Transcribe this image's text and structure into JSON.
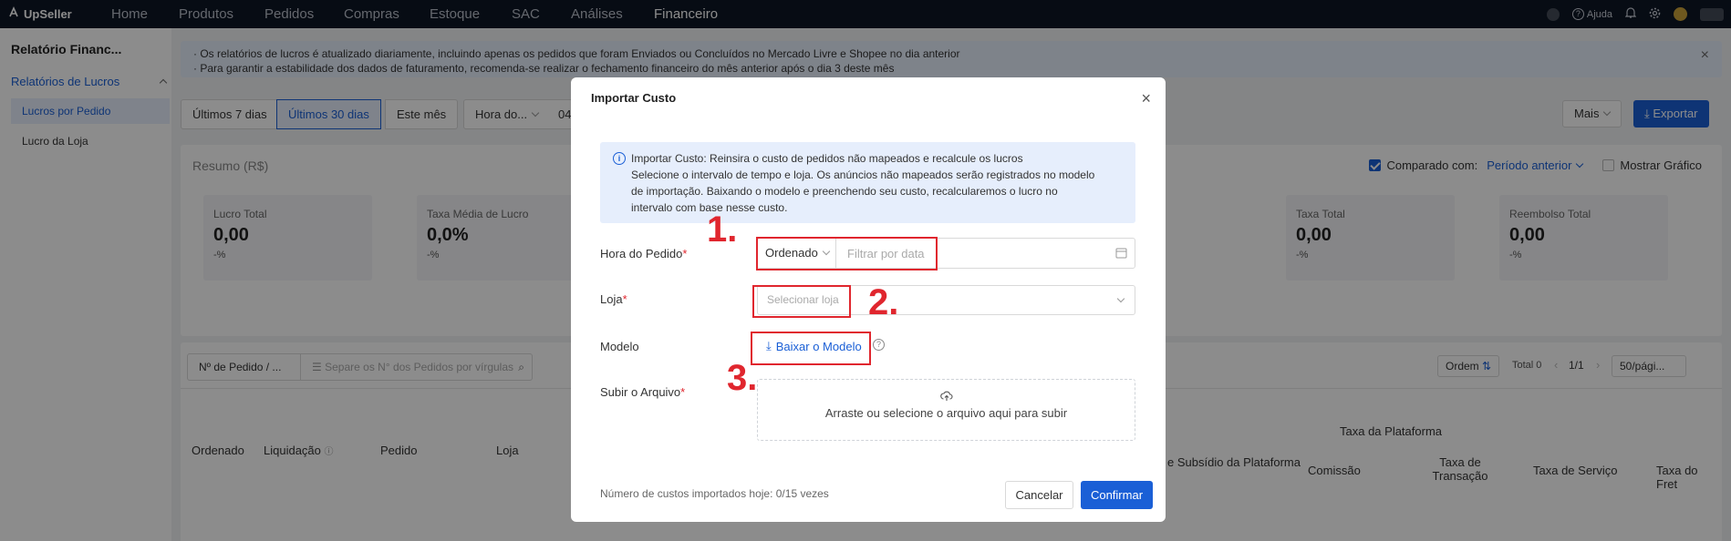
{
  "topnav": {
    "logo": "UpSeller",
    "items": [
      "Home",
      "Produtos",
      "Pedidos",
      "Compras",
      "Estoque",
      "SAC",
      "Análises",
      "Financeiro"
    ],
    "help": "Ajuda"
  },
  "sidebar": {
    "title": "Relatório Financ...",
    "group": "Relatórios de Lucros",
    "items": [
      "Lucros por Pedido",
      "Lucro da Loja"
    ]
  },
  "banner": {
    "line1": "· Os relatórios de lucros é atualizado diariamente, incluindo apenas os pedidos que foram Enviados ou Concluídos no Mercado Livre e Shopee no dia anterior",
    "line2": "· Para garantir a estabilidade dos dados de faturamento, recomenda-se realizar o fechamento financeiro do mês anterior após o dia 3 deste mês"
  },
  "filters": {
    "tabs": [
      "Últimos 7 dias",
      "Últimos 30 dias",
      "Este mês"
    ],
    "time_select": "Hora do...",
    "date_partial": "04",
    "more": "Mais",
    "export": "Exportar"
  },
  "summary": {
    "title": "Resumo (R$)",
    "compare_label": "Comparado com:",
    "compare_value": "Período anterior",
    "show_chart": "Mostrar Gráfico",
    "metrics": [
      {
        "label": "Lucro Total",
        "value": "0,00",
        "pct": "-%"
      },
      {
        "label": "Taxa Média de Lucro",
        "value": "0,0%",
        "pct": "-%"
      },
      {
        "label": "Taxa Total",
        "value": "0,00",
        "pct": "-%"
      },
      {
        "label": "Reembolso Total",
        "value": "0,00",
        "pct": "-%"
      }
    ]
  },
  "table": {
    "search_select": "Nº de Pedido / ...",
    "search_placeholder": "Separe os N° dos Pedidos por vírgulas",
    "order_btn": "Ordem",
    "total": "Total 0",
    "pager": "1/1",
    "page_size": "50/pági...",
    "platform_fee_group": "Taxa da Plataforma",
    "columns": [
      "Ordenado",
      "Liquidação",
      "Pedido",
      "Loja"
    ],
    "subsidy_col": "e Subsídio da Plataforma",
    "fee_cols": [
      "Comissão",
      "Taxa de Transação",
      "Taxa de Serviço",
      "Taxa do Fret"
    ]
  },
  "modal": {
    "title": "Importar Custo",
    "info_lines": [
      "Importar Custo: Reinsira o custo de pedidos não mapeados e recalcule os lucros",
      "Selecione o intervalo de tempo e loja. Os anúncios não mapeados serão registrados no modelo",
      "de importação. Baixando o modelo e preenchendo seu custo, recalcularemos o lucro no",
      "intervalo com base nesse custo."
    ],
    "order_time_label": "Hora do Pedido",
    "order_time_select": "Ordenado",
    "date_placeholder": "Filtrar por data",
    "store_label": "Loja",
    "store_placeholder": "Selecionar loja",
    "template_label": "Modelo",
    "download_link": "Baixar o Modelo",
    "upload_label": "Subir o Arquivo",
    "upload_text": "Arraste ou selecione o arquivo aqui para subir",
    "footer_note": "Número de custos importados hoje: 0/15 vezes",
    "cancel": "Cancelar",
    "confirm": "Confirmar",
    "required_mark": "*"
  },
  "annotations": {
    "step1": "1.",
    "step2": "2.",
    "step3": "3."
  },
  "colors": {
    "accent": "#1a5fd6",
    "annotation": "#e0262e",
    "nav_bg": "#0d1626"
  }
}
